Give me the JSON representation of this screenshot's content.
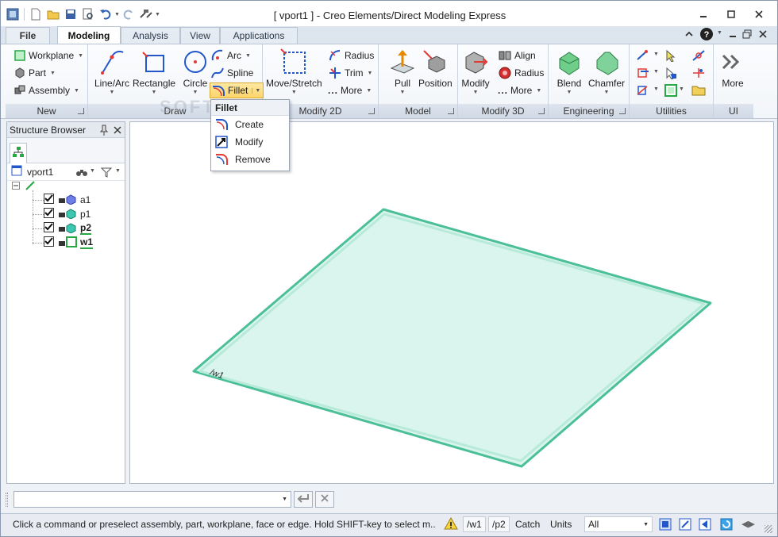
{
  "window": {
    "title": "[ vport1 ] - Creo Elements/Direct Modeling Express"
  },
  "tabs": [
    "File",
    "Modeling",
    "Analysis",
    "View",
    "Applications"
  ],
  "ribbon": {
    "new": {
      "workplane": "Workplane",
      "part": "Part",
      "assembly": "Assembly",
      "label": "New"
    },
    "draw": {
      "line_arc": "Line/Arc",
      "rectangle": "Rectangle",
      "circle": "Circle",
      "arc": "Arc",
      "spline": "Spline",
      "fillet": "Fillet",
      "label": "Draw"
    },
    "modify2d": {
      "move_stretch": "Move/Stretch",
      "radius": "Radius",
      "trim": "Trim",
      "more": "More",
      "label": "Modify 2D"
    },
    "model": {
      "pull": "Pull",
      "position": "Position",
      "label": "Model"
    },
    "modify3d": {
      "modify": "Modify",
      "align": "Align",
      "radius": "Radius",
      "more": "More",
      "label": "Modify 3D"
    },
    "engineering": {
      "blend": "Blend",
      "chamfer": "Chamfer",
      "label": "Engineering"
    },
    "utilities": {
      "label": "Utilities"
    },
    "ui": {
      "more": "More",
      "label": "UI"
    }
  },
  "fillet_menu": {
    "header": "Fillet",
    "items": [
      "Create",
      "Modify",
      "Remove"
    ]
  },
  "structure_browser": {
    "title": "Structure Browser",
    "viewport": "vport1",
    "items": [
      "a1",
      "p1",
      "p2",
      "w1"
    ]
  },
  "viewport": {
    "workplane_label": "/w1"
  },
  "status": {
    "message": "Click a command or preselect assembly, part, workplane, face or edge. Hold SHIFT-key to select m...",
    "workplane": "/w1",
    "part": "/p2",
    "catch": "Catch",
    "units": "Units",
    "filter": "All"
  },
  "watermark": "SOFTPEDIA",
  "colors": {
    "plane_fill": "#d9f4ec",
    "plane_edge": "#4bbf98",
    "fillet_highlight": "#fcd66a"
  }
}
